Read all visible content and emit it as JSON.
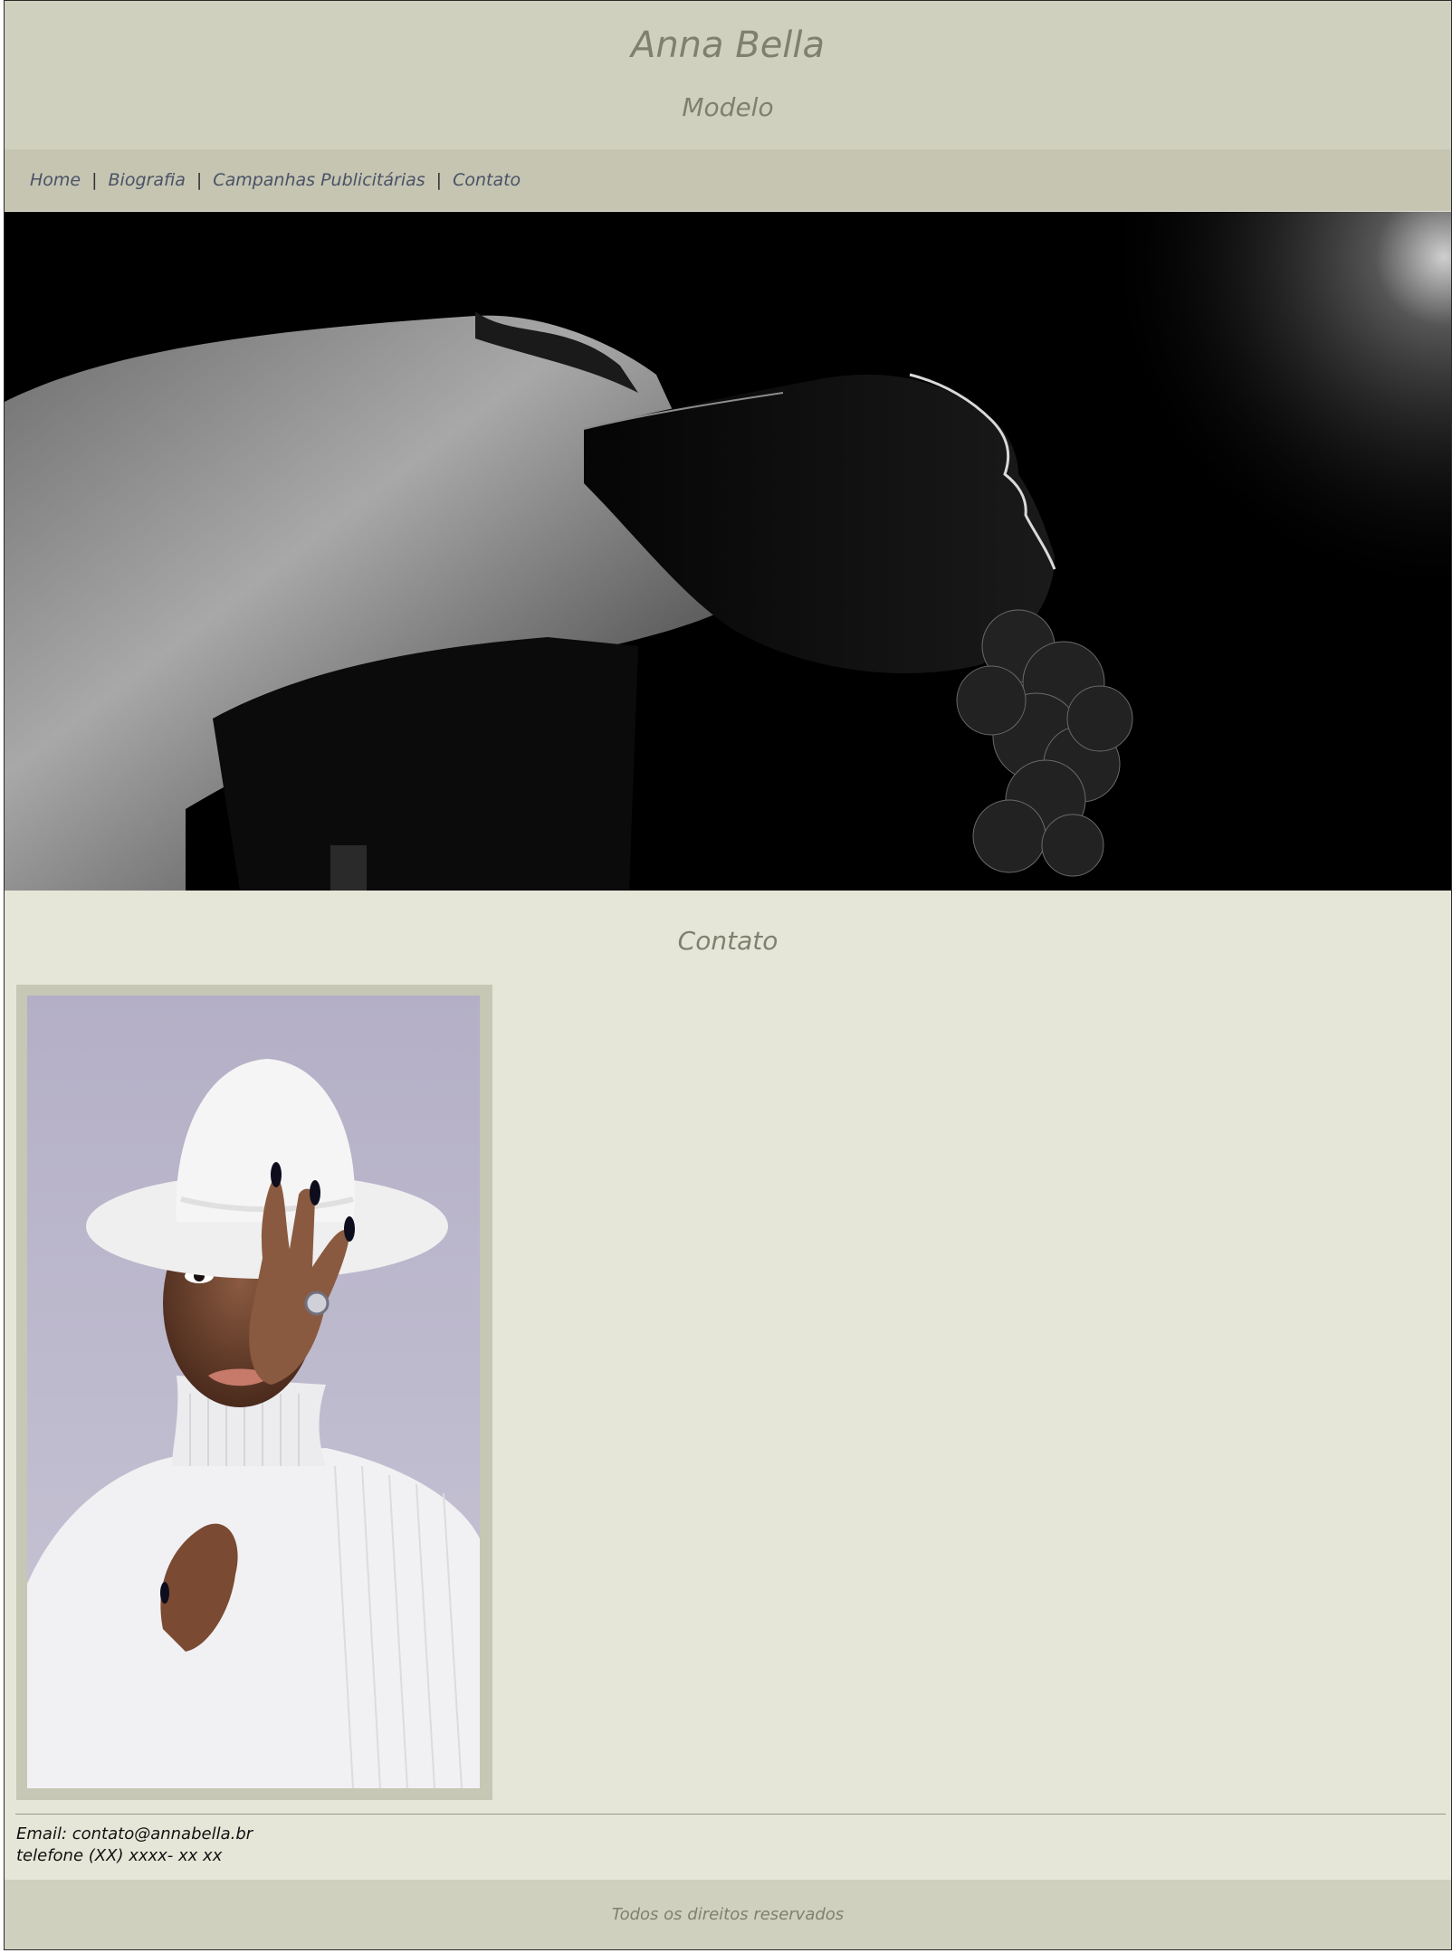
{
  "header": {
    "title": "Anna Bella",
    "subtitle": "Modelo"
  },
  "nav": {
    "items": [
      {
        "label": "Home"
      },
      {
        "label": "Biografia"
      },
      {
        "label": "Campanhas Publicitárias"
      },
      {
        "label": "Contato"
      }
    ],
    "separator": "|"
  },
  "main": {
    "section_title": "Contato",
    "contact": {
      "email": "Email: contato@annabella.br",
      "phone": "telefone (XX) xxxx- xx xx"
    }
  },
  "footer": {
    "text": "Todos os direitos reservados"
  },
  "colors": {
    "header_bg": "#d0d0bf",
    "nav_bg": "#c5c5b2",
    "page_bg": "#e6e6d8",
    "title_text": "#7f806f"
  }
}
